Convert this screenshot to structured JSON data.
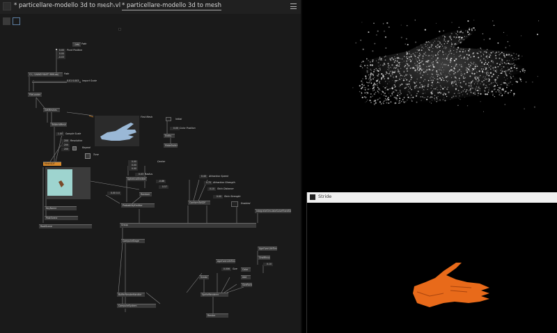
{
  "tabs": [
    {
      "label": "* particellare-modello 3d to mesh.vl"
    },
    {
      "label": "* particellare-modello 3d to mesh"
    }
  ],
  "nav_arrows": "◀ ▶ ▸",
  "nodes": {
    "filename": "C:\\...\\HAND MASTI MIN.obj",
    "fileloader": "FileLoader",
    "getmeshes": "GetMeshes",
    "toworldmesh": "ToWorldMesh",
    "meshsdf": "MeshSDF",
    "keyname": "KeyName",
    "postscene": "PostScene",
    "spherical": "SphericalEmitter",
    "random": "Random",
    "probability": "ProbabilityEmitter",
    "conformsdf": "ConformToSDF",
    "integrate": "IntegrateSimulateSolveFixedStep",
    "group": "Group",
    "computestage": "ComputeStage",
    "bufferrender": "BufferRenderHandler",
    "computesystem": "ComputeSystem",
    "spriterender": "SpriteRenderer",
    "ageoverlife1": "AgeOverLifeTime",
    "ageoverlife2": "AgeOverLifeTime",
    "oneminus": "OneMinus",
    "color": "Color",
    "add": "Add",
    "scalar": "Scalar",
    "sizefactor": "SizeFactor",
    "getentity": "Entity",
    "makeswitch": "MakeSwitch",
    "rootscene": "RootScene",
    "render": "Render"
  },
  "values": {
    "path_top": "..\\obj",
    "pivot_x": "0.00",
    "pivot_y": "0.00",
    "pivot_z": "-0.03",
    "import_scale": "0.01 0.003",
    "sample_scale": "1.00",
    "res_x": "200",
    "res_y": "200",
    "res_z": "200",
    "center_x": "0.00",
    "center_y": "0.00",
    "center_z": "0.00",
    "radius": "0.03",
    "rand_a": "-0.86",
    "rand_b": "0.57",
    "prob": "0.00 0.0",
    "attraction_speed": "0.40",
    "attraction_strength": "0.70",
    "stick_distance": "0.10",
    "stick_strength": "0.00",
    "color_pos": "0.00",
    "size": "0.006",
    "age_val": "0.10"
  },
  "labels": {
    "path": "Path",
    "pivot": "Pivot Position",
    "import_scale": "Import Scale",
    "sample_scale": "Sample Scale",
    "resolution": "Resolution",
    "repeat": "Repeat",
    "tone": "Tone",
    "first_mesh": "First Mesh",
    "initial": "Initial",
    "color_position": "Color Position",
    "center": "Center",
    "radius": "Radius",
    "attraction_speed": "Attraction Speed",
    "attraction_strength": "Attraction Strength",
    "stick_distance": "Stick Distance",
    "stick_strength": "Stick Strength",
    "enabled": "Enabled",
    "size": "Size"
  },
  "stride_window": {
    "title": "Stride"
  },
  "colors": {
    "editor_bg": "#1a1a1a",
    "node": "#3a3a3a",
    "accent": "#d8892a",
    "particle": "#d8d8d8",
    "hand": "#e86a1a"
  }
}
